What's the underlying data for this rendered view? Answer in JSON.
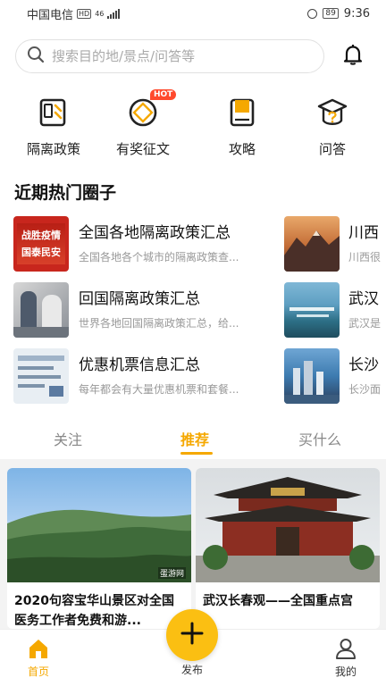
{
  "status_bar": {
    "carrier": "中国电信",
    "network_badge": "HD",
    "signal_label": "46",
    "battery": "89",
    "time": "9:36"
  },
  "search": {
    "placeholder": "搜索目的地/景点/问答等",
    "icon": "search-icon"
  },
  "header": {
    "bell_icon": "bell-icon"
  },
  "quick_entries": [
    {
      "label": "隔离政策",
      "icon": "policy-book-icon"
    },
    {
      "label": "有奖征文",
      "icon": "prize-coin-icon",
      "badge": "HOT"
    },
    {
      "label": "攻略",
      "icon": "guide-book-icon"
    },
    {
      "label": "问答",
      "icon": "qa-cap-icon"
    }
  ],
  "section": {
    "title": "近期热门圈子"
  },
  "circles": [
    {
      "title": "全国各地隔离政策汇总",
      "desc": "全国各地各个城市的隔离政策查...",
      "thumb_text": "战胜疫情\n国泰民安"
    },
    {
      "title": "回国隔离政策汇总",
      "desc": "世界各地回国隔离政策汇总，给..."
    },
    {
      "title": "优惠机票信息汇总",
      "desc": "每年都会有大量优惠机票和套餐..."
    }
  ],
  "circles_right": [
    {
      "title": "川西",
      "desc": "川西很"
    },
    {
      "title": "武汉",
      "desc": "武汉是"
    },
    {
      "title": "长沙",
      "desc": "长沙面"
    }
  ],
  "tabs": [
    {
      "label": "关注"
    },
    {
      "label": "推荐",
      "active": true
    },
    {
      "label": "买什么"
    }
  ],
  "feed": [
    {
      "title": "2020句容宝华山景区对全国医务工作者免费和游...",
      "watermark": "蛋游网"
    },
    {
      "title": "武汉长春观——全国重点宫"
    }
  ],
  "bottom_nav": {
    "home": "首页",
    "publish": "发布",
    "mine": "我的"
  },
  "colors": {
    "accent": "#f5a800",
    "fab": "#fbbf12",
    "hot_badge": "#ff4a2d"
  }
}
